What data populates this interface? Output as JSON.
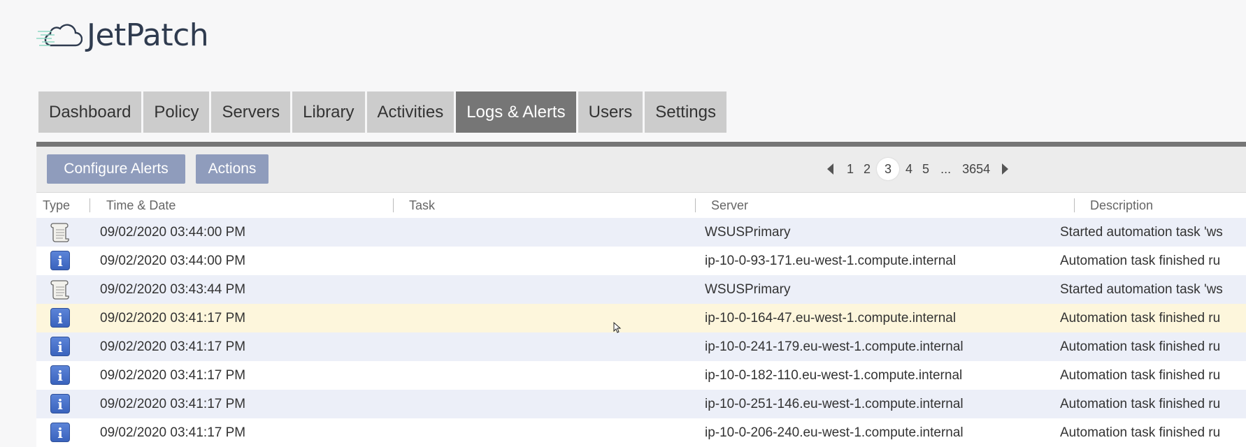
{
  "app": {
    "brand": "JetPatch"
  },
  "tabs": [
    {
      "label": "Dashboard",
      "active": false
    },
    {
      "label": "Policy",
      "active": false
    },
    {
      "label": "Servers",
      "active": false
    },
    {
      "label": "Library",
      "active": false
    },
    {
      "label": "Activities",
      "active": false
    },
    {
      "label": "Logs & Alerts",
      "active": true
    },
    {
      "label": "Users",
      "active": false
    },
    {
      "label": "Settings",
      "active": false
    }
  ],
  "toolbar": {
    "configure_label": "Configure Alerts",
    "actions_label": "Actions"
  },
  "pagination": {
    "pages": [
      "1",
      "2",
      "3",
      "4",
      "5"
    ],
    "current": "3",
    "ellipsis": "...",
    "last": "3654"
  },
  "table": {
    "columns": [
      "Type",
      "Time & Date",
      "Task",
      "Server",
      "Description"
    ],
    "rows": [
      {
        "type": "log-scroll-icon",
        "time": "09/02/2020 03:44:00 PM",
        "task": "",
        "server": "WSUSPrimary",
        "description": "Started automation task 'ws"
      },
      {
        "type": "info-icon",
        "time": "09/02/2020 03:44:00 PM",
        "task": "",
        "server": "ip-10-0-93-171.eu-west-1.compute.internal",
        "description": "Automation task finished ru"
      },
      {
        "type": "log-scroll-icon",
        "time": "09/02/2020 03:43:44 PM",
        "task": "",
        "server": "WSUSPrimary",
        "description": "Started automation task 'ws"
      },
      {
        "type": "info-icon",
        "time": "09/02/2020 03:41:17 PM",
        "task": "",
        "server": "ip-10-0-164-47.eu-west-1.compute.internal",
        "description": "Automation task finished ru"
      },
      {
        "type": "info-icon",
        "time": "09/02/2020 03:41:17 PM",
        "task": "",
        "server": "ip-10-0-241-179.eu-west-1.compute.internal",
        "description": "Automation task finished ru"
      },
      {
        "type": "info-icon",
        "time": "09/02/2020 03:41:17 PM",
        "task": "",
        "server": "ip-10-0-182-110.eu-west-1.compute.internal",
        "description": "Automation task finished ru"
      },
      {
        "type": "info-icon",
        "time": "09/02/2020 03:41:17 PM",
        "task": "",
        "server": "ip-10-0-251-146.eu-west-1.compute.internal",
        "description": "Automation task finished ru"
      },
      {
        "type": "info-icon",
        "time": "09/02/2020 03:41:17 PM",
        "task": "",
        "server": "ip-10-0-206-240.eu-west-1.compute.internal",
        "description": "Automation task finished ru"
      }
    ]
  },
  "colors": {
    "tab_active": "#767676",
    "tab_inactive": "#cccccc",
    "button": "#8f9cbc",
    "row_alt": "#eceff8",
    "row_hover": "#fdf6dc",
    "info_icon": "#4a72cc"
  }
}
